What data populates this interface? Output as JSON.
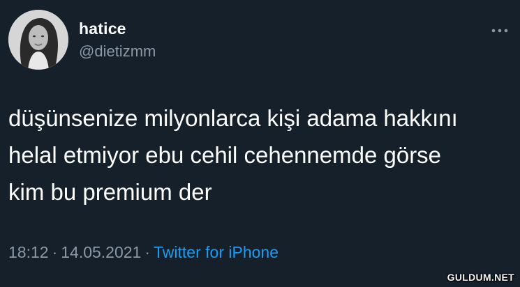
{
  "tweet": {
    "display_name": "hatice",
    "handle": "@dietizmm",
    "text_lines": [
      "düşünsenize milyonlarca kişi adama hakkını",
      "helal etmiyor ebu cehil cehennemde görse",
      "kim bu premium der"
    ],
    "time": "18:12",
    "date": "14.05.2021",
    "separator": "·",
    "source": "Twitter for iPhone"
  },
  "icons": {
    "more": "more-horizontal-icon",
    "avatar": "profile-photo"
  },
  "watermark": "GULDUM.NET",
  "colors": {
    "background": "#15202b",
    "text": "#ffffff",
    "secondary": "#8b98a5",
    "link": "#1d9bf0"
  }
}
